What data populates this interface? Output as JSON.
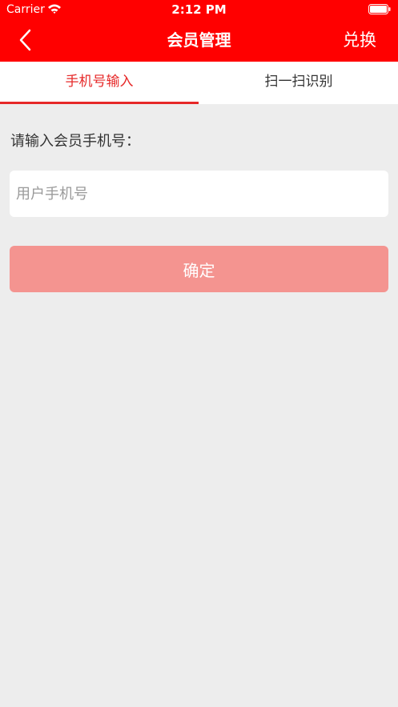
{
  "status_bar": {
    "carrier": "Carrier",
    "time": "2:12 PM"
  },
  "nav_bar": {
    "title": "会员管理",
    "redeem_label": "兑换",
    "background_color": "#ff0000"
  },
  "tabs": [
    {
      "label": "手机号输入",
      "active": true
    },
    {
      "label": "扫一扫识别",
      "active": false
    }
  ],
  "form": {
    "prompt": "请输入会员手机号：",
    "phone_placeholder": "用户手机号",
    "phone_value": "",
    "confirm_label": "确定"
  },
  "icons": {
    "back": "chevron-left-icon",
    "wifi": "wifi-icon",
    "battery": "battery-icon"
  },
  "colors": {
    "accent": "#e62828",
    "confirm_disabled": "#f49490",
    "page_background": "#ededed"
  }
}
